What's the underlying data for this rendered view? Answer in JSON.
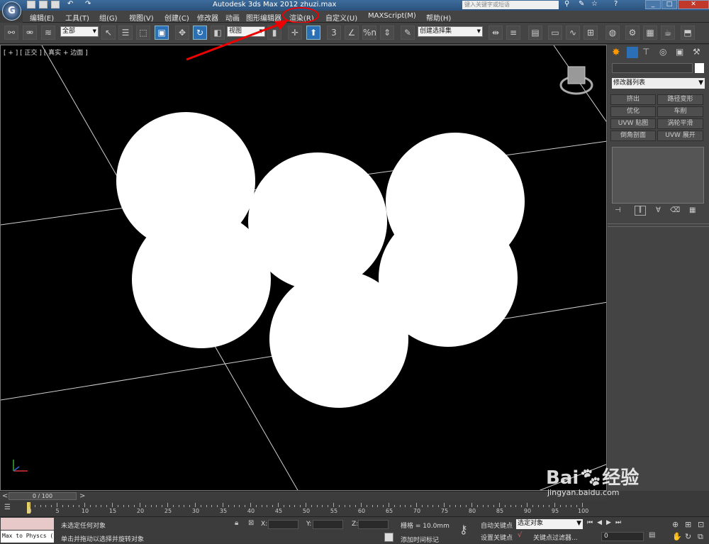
{
  "window": {
    "title": "Autodesk 3ds Max  2012      zhuzi.max",
    "search_placeholder": "键入关键字或短语",
    "logo_letter": "G"
  },
  "menu": {
    "items": [
      "编辑(E)",
      "工具(T)",
      "组(G)",
      "视图(V)",
      "创建(C)",
      "修改器",
      "动画",
      "图形编辑器",
      "渲染(R)",
      "自定义(U)",
      "MAXScript(M)",
      "帮助(H)"
    ]
  },
  "toolbar": {
    "selection_filter": "全部",
    "reference_coord": "视图",
    "named_selection": "创建选择集",
    "snap_label": "3",
    "percent_snap": "%n"
  },
  "viewport": {
    "label": "[ + ] [ 正交 ] [ 真实 + 边面 ]"
  },
  "command_panel": {
    "modifier_list": "修改器列表",
    "buttons": [
      "挤出",
      "路径变形",
      "优化",
      "车削",
      "UVW 贴图",
      "涡轮平滑",
      "倒角剖面",
      "UVW 展开"
    ]
  },
  "timeline": {
    "frame_counter": "0 / 100",
    "ticks": [
      "0",
      "5",
      "10",
      "15",
      "20",
      "25",
      "30",
      "35",
      "40",
      "45",
      "50",
      "55",
      "60",
      "65",
      "70",
      "75",
      "80",
      "85",
      "90",
      "95",
      "100"
    ]
  },
  "status": {
    "maxscript_listener": "Max to Physcs (",
    "selection_status": "未选定任何对象",
    "prompt": "单击并拖动以选择并旋转对象",
    "x_label": "X:",
    "y_label": "Y:",
    "z_label": "Z:",
    "grid": "栅格 = 10.0mm",
    "add_time_tag": "添加时间标记",
    "auto_key": "自动关键点",
    "set_key": "设置关键点",
    "selected_dropdown": "选定对象",
    "key_filters": "关键点过滤器...",
    "current_frame": "0"
  },
  "watermark": {
    "brand": "Bai",
    "product": "经验",
    "url": "jingyan.baidu.com"
  },
  "colors": {
    "title_bar": "#2b527c",
    "ui_dark": "#444444",
    "viewport_bg": "#000000",
    "annotation": "#ee0000",
    "active_button": "#2b6fb4"
  }
}
